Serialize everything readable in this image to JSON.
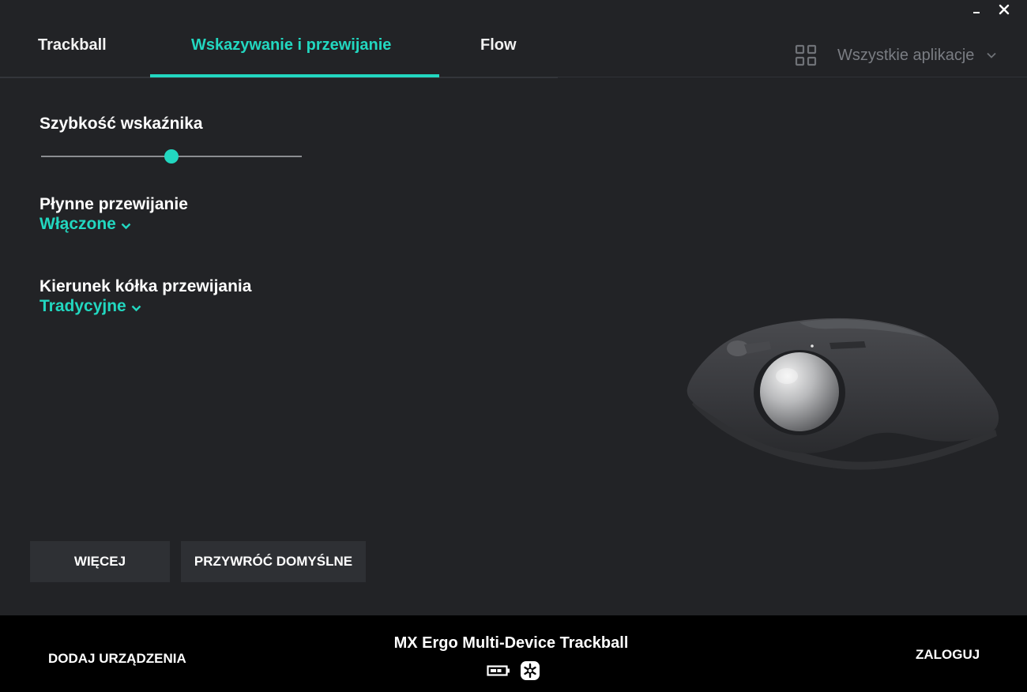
{
  "tabs": [
    {
      "label": "Trackball",
      "active": false
    },
    {
      "label": "Wskazywanie i przewijanie",
      "active": true
    },
    {
      "label": "Flow",
      "active": false
    }
  ],
  "app_selector": {
    "label": "Wszystkie aplikacje",
    "icon": "apps-grid-icon"
  },
  "settings": {
    "pointer_speed": {
      "title": "Szybkość wskaźnika",
      "value_fraction": 0.5
    },
    "smooth_scrolling": {
      "title": "Płynne przewijanie",
      "value": "Włączone"
    },
    "scroll_direction": {
      "title": "Kierunek kółka przewijania",
      "value": "Tradycyjne"
    }
  },
  "buttons": {
    "more": "WIĘCEJ",
    "restore_defaults": "PRZYWRÓĆ DOMYŚLNE"
  },
  "footer": {
    "add_devices": "DODAJ URZĄDZENIA",
    "device_name": "MX Ergo Multi-Device Trackball",
    "login": "ZALOGUJ",
    "battery_icon": "battery-icon",
    "connection_icon": "unifying-receiver-icon"
  },
  "colors": {
    "accent": "#22d7c0",
    "background": "#222326",
    "footer": "#000000",
    "button": "#2e3034"
  }
}
